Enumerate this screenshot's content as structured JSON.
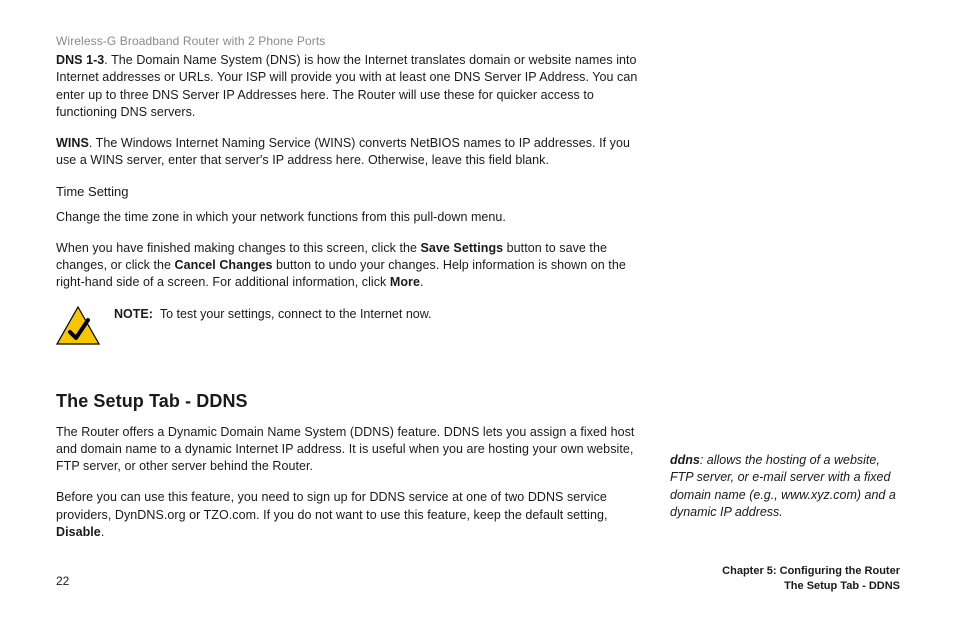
{
  "header": {
    "title": "Wireless-G Broadband Router with 2 Phone Ports"
  },
  "dns": {
    "label": "DNS 1-3",
    "text": ". The Domain Name System (DNS) is how the Internet translates domain or website names into Internet addresses or URLs. Your ISP will provide you with at least one DNS Server IP Address. You can enter up to three DNS Server IP Addresses here. The Router will use these for quicker access to functioning DNS servers."
  },
  "wins": {
    "label": "WINS",
    "text": ". The Windows Internet Naming Service (WINS) converts NetBIOS names to IP addresses. If you use a WINS server, enter that server's IP address here. Otherwise, leave this field blank."
  },
  "time": {
    "heading": "Time Setting",
    "text": "Change the time zone in which your network functions from this pull-down menu."
  },
  "save": {
    "pre": "When you have finished making changes to this screen, click the ",
    "btn1": "Save Settings",
    "mid1": " button to save the changes, or click the ",
    "btn2": "Cancel Changes",
    "mid2": " button to undo your changes. Help information is shown on the right-hand side of a screen. For additional information, click ",
    "btn3": "More",
    "post": "."
  },
  "note": {
    "label": "NOTE:",
    "text": "To test your settings, connect to the Internet now."
  },
  "ddns": {
    "title": "The Setup Tab - DDNS",
    "p1": "The Router offers a Dynamic Domain Name System (DDNS) feature. DDNS lets you assign a fixed host and domain name to a dynamic Internet IP address. It is useful when you are hosting your own website, FTP server, or other server behind the Router.",
    "p2_pre": "Before you can use this feature, you need to sign up for DDNS service at one of two DDNS service providers, DynDNS.org or TZO.com. If you do not want to use this feature, keep the default setting, ",
    "p2_bold": "Disable",
    "p2_post": "."
  },
  "glossary": {
    "term": "ddns",
    "def": ": allows the hosting of a website, FTP server, or e-mail server with a fixed domain name (e.g., www.xyz.com) and a dynamic IP address."
  },
  "footer": {
    "page": "22",
    "chapter": "Chapter 5: Configuring the Router",
    "section": "The Setup Tab - DDNS"
  }
}
